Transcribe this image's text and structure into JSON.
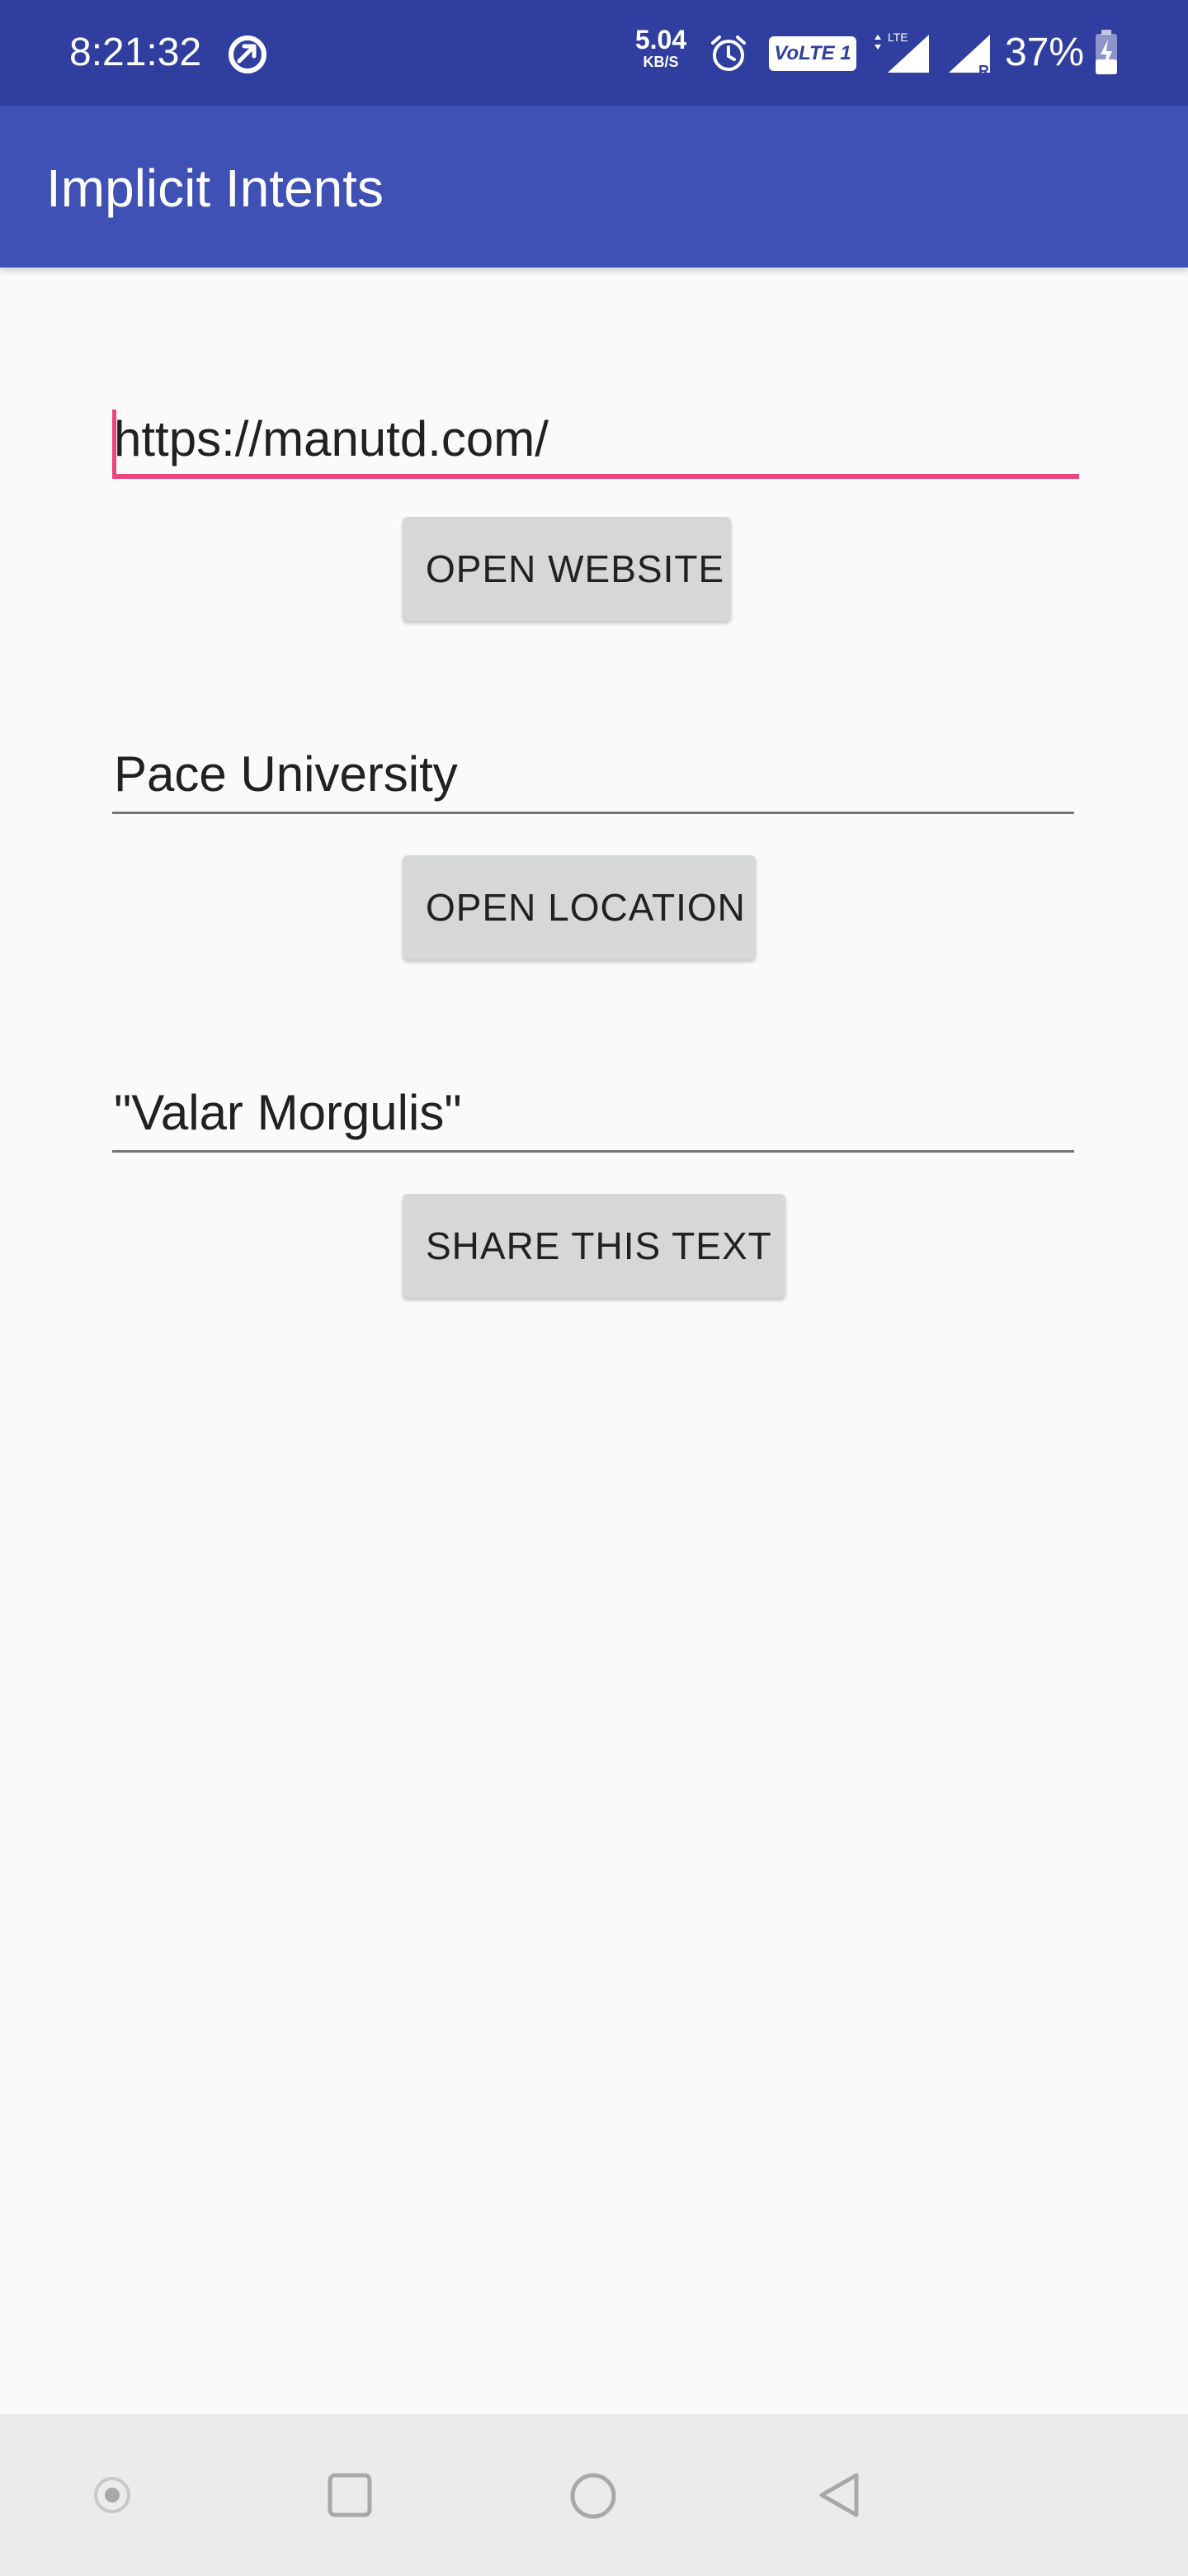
{
  "status_bar": {
    "time": "8:21:32",
    "network_speed": "5.04",
    "network_speed_unit": "KB/S",
    "volte_label": "VoLTE 1",
    "battery_percent": "37%",
    "icons": [
      "data-saver-icon",
      "alarm-icon",
      "volte-icon",
      "lte-signal-icon",
      "roaming-signal-icon",
      "battery-charging-icon"
    ]
  },
  "app_bar": {
    "title": "Implicit Intents"
  },
  "main": {
    "website_field": {
      "value": "https://manutd.com/"
    },
    "website_button": {
      "label": "OPEN WEBSITE"
    },
    "location_field": {
      "value": "Pace University"
    },
    "location_button": {
      "label": "OPEN LOCATION"
    },
    "share_field": {
      "value": "\"Valar Morgulis\""
    },
    "share_button": {
      "label": "SHARE THIS TEXT"
    }
  },
  "nav_bar": {
    "icons": [
      "assistant-dot-icon",
      "recents-square-icon",
      "home-circle-icon",
      "back-triangle-icon"
    ]
  },
  "colors": {
    "status_bar": "#303f9f",
    "app_bar": "#3f51b5",
    "accent": "#e8467c",
    "background": "#fafafa",
    "button": "#d6d7d7",
    "nav_bar": "#ebebeb"
  }
}
